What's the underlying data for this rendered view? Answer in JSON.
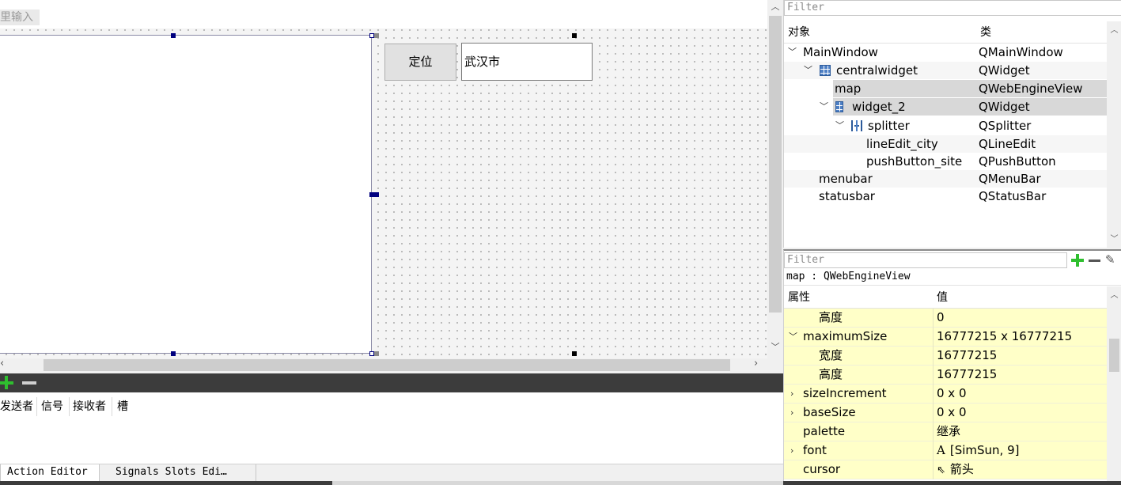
{
  "canvas": {
    "placeholder_stub": "里输入",
    "button_site_label": "定位",
    "line_edit_city_value": "武汉市"
  },
  "signal_editor": {
    "headers": [
      "发送者",
      "信号",
      "接收者",
      "槽"
    ],
    "tabs": [
      "Action Editor",
      "Signals  Slots Edi…"
    ]
  },
  "object_inspector": {
    "filter_placeholder": "Filter",
    "header_object": "对象",
    "header_class": "类",
    "rows": [
      {
        "name": "MainWindow",
        "class": "QMainWindow"
      },
      {
        "name": "centralwidget",
        "class": "QWidget"
      },
      {
        "name": "map",
        "class": "QWebEngineView"
      },
      {
        "name": "widget_2",
        "class": "QWidget"
      },
      {
        "name": "splitter",
        "class": "QSplitter"
      },
      {
        "name": "lineEdit_city",
        "class": "QLineEdit"
      },
      {
        "name": "pushButton_site",
        "class": "QPushButton"
      },
      {
        "name": "menubar",
        "class": "QMenuBar"
      },
      {
        "name": "statusbar",
        "class": "QStatusBar"
      }
    ]
  },
  "property_editor": {
    "filter_placeholder": "Filter",
    "caption": "map : QWebEngineView",
    "header_property": "属性",
    "header_value": "值",
    "rows": [
      {
        "name": "高度",
        "value": "0"
      },
      {
        "name": "maximumSize",
        "value": "16777215 x 16777215"
      },
      {
        "name": "宽度",
        "value": "16777215"
      },
      {
        "name": "高度",
        "value": "16777215"
      },
      {
        "name": "sizeIncrement",
        "value": "0 x 0"
      },
      {
        "name": "baseSize",
        "value": "0 x 0"
      },
      {
        "name": "palette",
        "value": "继承"
      },
      {
        "name": "font",
        "value": "[SimSun, 9]"
      },
      {
        "name": "cursor",
        "value": "箭头"
      }
    ]
  },
  "colors": {
    "property_row_bg": "#ffffc8",
    "selection_handle": "#00007f",
    "toolbar_dark": "#3c3c3c",
    "add_green": "#2fbf2f"
  }
}
